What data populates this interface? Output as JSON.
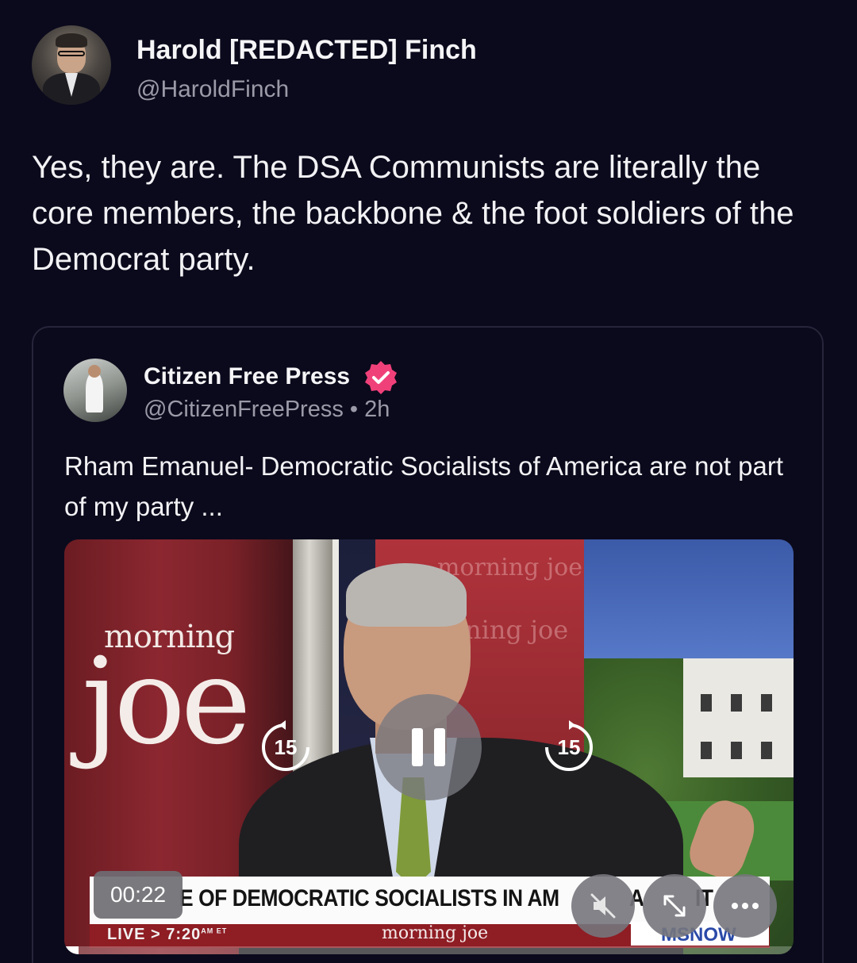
{
  "post": {
    "author_name": "Harold [REDACTED] Finch",
    "author_handle": "@HaroldFinch",
    "text": "Yes, they are. The DSA Communists are literally the core members, the backbone & the foot soldiers of the Democrat party."
  },
  "quote": {
    "author_name": "Citizen Free Press",
    "meta": "@CitizenFreePress • 2h",
    "text": "Rham Emanuel- Democratic Socialists of America are not part of my party ...",
    "verified_color": "#f0407a"
  },
  "video": {
    "show_logo_top": "morning",
    "show_logo_bottom": "joe",
    "watermark_1": "morning joe",
    "watermark_2": "ning joe",
    "banner_text": "E OF DEMOCRATIC SOCIALISTS IN AM",
    "banner_text_2": "A",
    "banner_text_3": "IT",
    "ticker_live": "LIVE > 7:20",
    "ticker_ampm": "AM ET",
    "ticker_show": "morning joe",
    "network_logo": "MSNOW",
    "elapsed": "00:22",
    "skip_back_label": "15",
    "skip_forward_label": "15",
    "progress": 0.02
  },
  "icons": {
    "pause": "pause-icon",
    "mute": "mute-icon",
    "expand": "expand-icon",
    "more": "more-icon",
    "skip_back": "skip-back-icon",
    "skip_forward": "skip-forward-icon",
    "verified": "verified-badge-icon"
  }
}
